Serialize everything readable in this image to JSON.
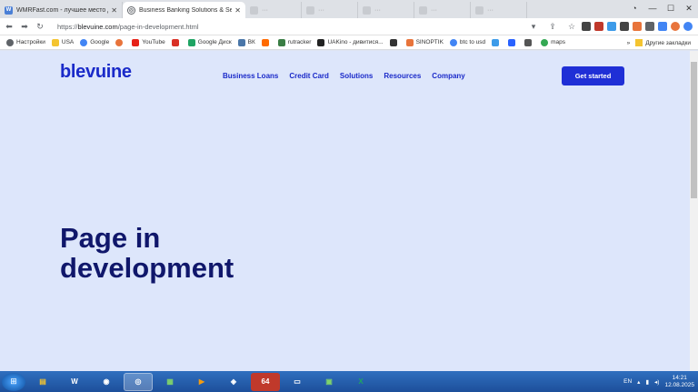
{
  "tabs": [
    {
      "title": "WMRFast.com - лучшее место для",
      "icon": "W",
      "color": "#4a7fd6"
    },
    {
      "title": "Business Banking Solutions & Serv",
      "icon": "◎",
      "color": "#5f6368"
    },
    {
      "title": "",
      "icon": "",
      "color": "#999"
    },
    {
      "title": "",
      "icon": "",
      "color": "#999"
    },
    {
      "title": "",
      "icon": "",
      "color": "#999"
    },
    {
      "title": "",
      "icon": "",
      "color": "#999"
    },
    {
      "title": "",
      "icon": "",
      "color": "#999"
    }
  ],
  "address": {
    "url_prefix": "https://",
    "url_host": "blevuine.com",
    "url_path": "/page-in-development.html"
  },
  "bookmarks": [
    {
      "label": "Настройки",
      "color": "#5f6368"
    },
    {
      "label": "USA",
      "color": "#f4c430"
    },
    {
      "label": "Google",
      "color": "#4285f4"
    },
    {
      "label": "",
      "color": "#e8743b"
    },
    {
      "label": "YouTube",
      "color": "#e62117"
    },
    {
      "label": "",
      "color": "#d93025"
    },
    {
      "label": "Google Диск",
      "color": "#1fa463"
    },
    {
      "label": "ВК",
      "color": "#4a76a8"
    },
    {
      "label": "",
      "color": "#ff6a00"
    },
    {
      "label": "rutracker",
      "color": "#3a7d44"
    },
    {
      "label": "UAKino - дивитися...",
      "color": "#222"
    },
    {
      "label": "",
      "color": "#333"
    },
    {
      "label": "SINOPTIK",
      "color": "#e8743b"
    },
    {
      "label": "btc to usd",
      "color": "#4285f4"
    },
    {
      "label": "",
      "color": "#3d9be9"
    },
    {
      "label": "",
      "color": "#2962ff"
    },
    {
      "label": "",
      "color": "#555"
    },
    {
      "label": "maps",
      "color": "#34a853"
    }
  ],
  "bookmarks_other": "Другие закладки",
  "site": {
    "logo": "blevuine",
    "nav": [
      "Business Loans",
      "Credit Card",
      "Solutions",
      "Resources",
      "Company"
    ],
    "cta": "Get started",
    "headline_line1": "Page in",
    "headline_line2": "development"
  },
  "tray": {
    "lang": "EN",
    "time": "14:21",
    "date": "12.08.2025"
  },
  "taskbar_apps": [
    "explorer",
    "wm",
    "chrome",
    "ie",
    "wm2",
    "media",
    "tool",
    "64",
    "folder",
    "notes",
    "excel"
  ]
}
